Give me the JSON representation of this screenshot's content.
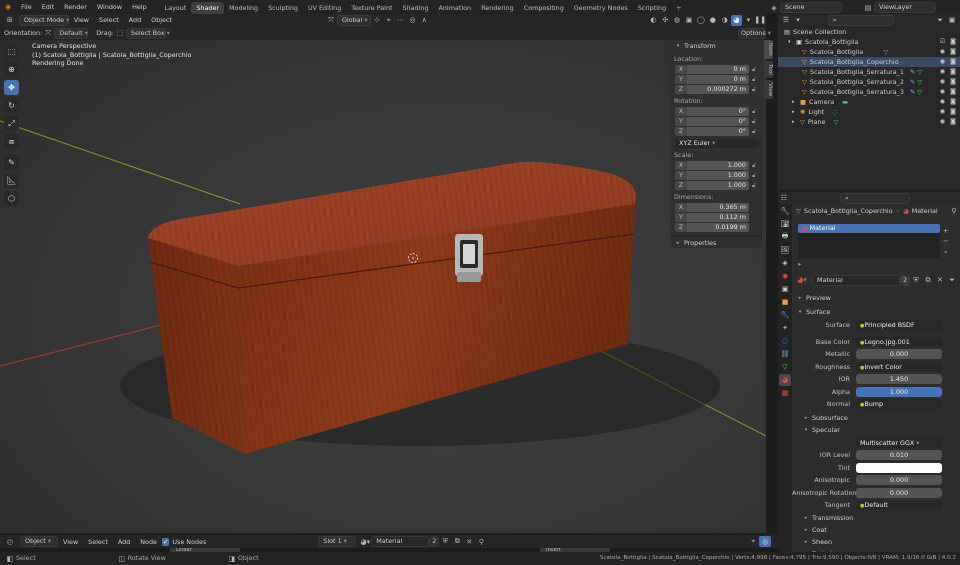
{
  "topbar": {
    "menus": [
      "File",
      "Edit",
      "Render",
      "Window",
      "Help"
    ],
    "workspaces": [
      "Layout",
      "Shader",
      "Modeling",
      "Sculpting",
      "UV Editing",
      "Texture Paint",
      "Shading",
      "Animation",
      "Rendering",
      "Compositing",
      "Geometry Nodes",
      "Scripting"
    ],
    "active_workspace": "Shader",
    "scene": "Scene",
    "view_layer": "ViewLayer"
  },
  "viewport_header": {
    "mode": "Object Mode",
    "menus": [
      "View",
      "Select",
      "Add",
      "Object"
    ],
    "transform_orientation": "Global",
    "options": "Options"
  },
  "tool_settings": {
    "orientation_label": "Orientation:",
    "orientation_value": "Default",
    "drag_label": "Drag:",
    "drag_value": "Select Box"
  },
  "viewport_info": {
    "line1": "Camera Perspective",
    "line2": "(1) Scatola_Bottiglia | Scatola_Bottiglia_Coperchio",
    "line3": "Rendering Done"
  },
  "n_panel": {
    "title": "Transform",
    "location_label": "Location:",
    "location": [
      {
        "axis": "X",
        "value": "0 m"
      },
      {
        "axis": "Y",
        "value": "0 m"
      },
      {
        "axis": "Z",
        "value": "0.000272 m"
      }
    ],
    "rotation_label": "Rotation:",
    "rotation": [
      {
        "axis": "X",
        "value": "0°"
      },
      {
        "axis": "Y",
        "value": "0°"
      },
      {
        "axis": "Z",
        "value": "0°"
      }
    ],
    "rotation_mode": "XYZ Euler",
    "scale_label": "Scale:",
    "scale": [
      {
        "axis": "X",
        "value": "1.000"
      },
      {
        "axis": "Y",
        "value": "1.000"
      },
      {
        "axis": "Z",
        "value": "1.000"
      }
    ],
    "dimensions_label": "Dimensions:",
    "dimensions": [
      {
        "axis": "X",
        "value": "0.365 m"
      },
      {
        "axis": "Y",
        "value": "0.112 m"
      },
      {
        "axis": "Z",
        "value": "0.0199 m"
      }
    ],
    "properties_label": "Properties",
    "tabs": [
      "Item",
      "Tool",
      "View"
    ]
  },
  "outliner": {
    "root": "Scene Collection",
    "collection": "Scatola_Bottiglia",
    "items": [
      "Scatola_Bottiglia",
      "Scatola_Bottiglia_Coperchio",
      "Scatola_Bottiglia_Serratura_1",
      "Scatola_Bottiglia_Serratura_2",
      "Scatola_Bottiglia_Serratura_3"
    ],
    "others": [
      "Camera",
      "Light",
      "Plane"
    ]
  },
  "properties": {
    "breadcrumb_object": "Scatola_Bottiglia_Coperchio",
    "breadcrumb_section": "Material",
    "slot_name": "Material",
    "material_name": "Material",
    "users": "2",
    "preview": "Preview",
    "surface_section": "Surface",
    "surface_label": "Surface",
    "surface_value": "Principled BSDF",
    "base_color_label": "Base Color",
    "base_color_value": "Legno.jpg.001",
    "metallic_label": "Metallic",
    "metallic_value": "0.000",
    "roughness_label": "Roughness",
    "roughness_value": "Invert Color",
    "ior_label": "IOR",
    "ior_value": "1.450",
    "alpha_label": "Alpha",
    "alpha_value": "1.000",
    "normal_label": "Normal",
    "normal_value": "Bump",
    "subsurface": "Subsurface",
    "specular": "Specular",
    "distribution": "Multiscatter GGX",
    "ior_level_label": "IOR Level",
    "ior_level_value": "0.010",
    "tint_label": "Tint",
    "anisotropic_label": "Anisotropic",
    "anisotropic_value": "0.000",
    "aniso_rot_label": "Anisotropic Rotation",
    "aniso_rot_value": "0.000",
    "tangent_label": "Tangent",
    "tangent_value": "Default",
    "transmission": "Transmission",
    "coat": "Coat",
    "sheen": "Sheen",
    "emission": "Emission"
  },
  "node_header": {
    "object": "Object",
    "menus": [
      "View",
      "Select",
      "Add",
      "Node"
    ],
    "use_nodes": "Use Nodes",
    "slot": "Slot 1",
    "material": "Material",
    "users": "2",
    "node_label_1": "Linear",
    "node_label_2": "Invert"
  },
  "statusbar": {
    "select": "Select",
    "rotate": "Rotate View",
    "object": "Object",
    "stats": "Scatola_Bottiglia | Scatola_Bottiglia_Coperchio | Verts:4,998 | Faces:4,795 | Tris:9,590 | Objects:0/8 | VRAM: 1.9/16.0 GiB | 4.0.2"
  },
  "colors": {
    "accent": "#4772b3",
    "wood": "#8a3a1c",
    "selected_row": "#3b4b63"
  }
}
